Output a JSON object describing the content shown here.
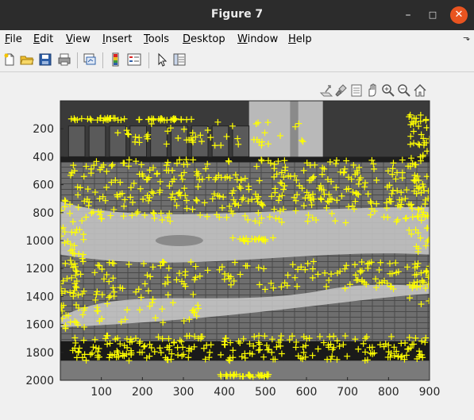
{
  "window": {
    "title": "Figure 7"
  },
  "window_controls": {
    "minimize": "–",
    "maximize": "□",
    "close": "✕"
  },
  "menu": {
    "items": [
      {
        "key": "F",
        "rest": "ile"
      },
      {
        "key": "E",
        "rest": "dit"
      },
      {
        "key": "V",
        "rest": "iew"
      },
      {
        "key": "I",
        "rest": "nsert"
      },
      {
        "key": "T",
        "rest": "ools"
      },
      {
        "key": "D",
        "rest": "esktop"
      },
      {
        "key": "W",
        "rest": "indow"
      },
      {
        "key": "H",
        "rest": "elp"
      }
    ],
    "overflow_icon": "arrow-corner-icon"
  },
  "toolbar": {
    "buttons": [
      "new-figure-icon",
      "open-file-icon",
      "save-icon",
      "print-icon",
      "link-plot-icon",
      "colorbar-icon",
      "legend-icon",
      "select-pointer-icon",
      "property-inspector-icon"
    ]
  },
  "axes_toolbar": {
    "buttons": [
      "export-icon",
      "brush-icon",
      "data-tips-icon",
      "pan-icon",
      "zoom-in-icon",
      "zoom-out-icon",
      "home-icon"
    ]
  },
  "colors": {
    "marker": "#ffff00",
    "titlebar": "#2c2c2c",
    "close": "#e95420"
  },
  "chart_data": {
    "type": "image-with-scatter-overlay",
    "image": "grayscale photograph of brick pavement with painted pattern, street curb and building",
    "overlay_marker": "+",
    "overlay_color": "yellow",
    "xlim": [
      0,
      900
    ],
    "ylim": [
      2000,
      0
    ],
    "xticks": [
      100,
      200,
      300,
      400,
      500,
      600,
      700,
      800,
      900
    ],
    "yticks": [
      200,
      400,
      600,
      800,
      1000,
      1200,
      1400,
      1600,
      1800,
      2000
    ],
    "xtick_labels": [
      "100",
      "200",
      "300",
      "400",
      "500",
      "600",
      "700",
      "800",
      "900"
    ],
    "ytick_labels": [
      "200",
      "400",
      "600",
      "800",
      "1000",
      "1200",
      "1400",
      "1600",
      "1800",
      "2000"
    ],
    "feature_clusters": [
      {
        "x": [
          10,
          160
        ],
        "y": [
          120,
          140
        ],
        "n": 25
      },
      {
        "x": [
          190,
          320
        ],
        "y": [
          125,
          140
        ],
        "n": 25
      },
      {
        "x": [
          20,
          900
        ],
        "y": [
          420,
          720
        ],
        "n": 260
      },
      {
        "x": [
          0,
          900
        ],
        "y": [
          700,
          880
        ],
        "n": 120
      },
      {
        "x": [
          0,
          60
        ],
        "y": [
          880,
          1650
        ],
        "n": 70
      },
      {
        "x": [
          850,
          900
        ],
        "y": [
          300,
          1500
        ],
        "n": 60
      },
      {
        "x": [
          80,
          350
        ],
        "y": [
          1150,
          1600
        ],
        "n": 80
      },
      {
        "x": [
          350,
          900
        ],
        "y": [
          1150,
          1350
        ],
        "n": 90
      },
      {
        "x": [
          420,
          520
        ],
        "y": [
          980,
          1010
        ],
        "n": 20
      },
      {
        "x": [
          20,
          900
        ],
        "y": [
          1680,
          1860
        ],
        "n": 230
      },
      {
        "x": [
          390,
          520
        ],
        "y": [
          1955,
          1980
        ],
        "n": 30
      },
      {
        "x": [
          140,
          600
        ],
        "y": [
          150,
          320
        ],
        "n": 50
      },
      {
        "x": [
          850,
          900
        ],
        "y": [
          100,
          320
        ],
        "n": 25
      }
    ]
  }
}
